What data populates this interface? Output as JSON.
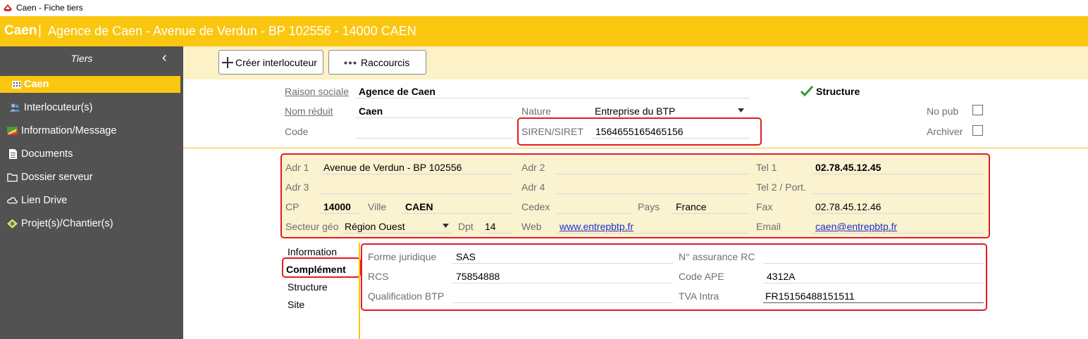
{
  "window": {
    "title": "Caen - Fiche tiers"
  },
  "header": {
    "name": "Caen",
    "separator": "|",
    "address": "Agence de Caen - Avenue de Verdun - BP 102556 - 14000 CAEN"
  },
  "sidebar": {
    "title": "Tiers",
    "collapse_glyph": "‹",
    "items": [
      {
        "label": "Caen",
        "icon": "building-icon"
      },
      {
        "label": "Interlocuteur(s)",
        "icon": "people-icon"
      },
      {
        "label": "Information/Message",
        "icon": "flag-icon"
      },
      {
        "label": "Documents",
        "icon": "document-icon"
      },
      {
        "label": "Dossier serveur",
        "icon": "folder-icon"
      },
      {
        "label": "Lien Drive",
        "icon": "cloud-icon"
      },
      {
        "label": "Projet(s)/Chantier(s)",
        "icon": "project-icon"
      }
    ]
  },
  "toolbar": {
    "create_label": "Créer interlocuteur",
    "shortcuts_label": "Raccourcis"
  },
  "identity": {
    "raison_sociale_label": "Raison sociale",
    "raison_sociale": "Agence de Caen",
    "structure_label": "Structure",
    "nom_reduit_label": "Nom réduit",
    "nom_reduit": "Caen",
    "nature_label": "Nature",
    "nature": "Entreprise du BTP",
    "no_pub_label": "No pub",
    "code_label": "Code",
    "code": "",
    "siren_label": "SIREN/SIRET",
    "siren": "1564655165465156",
    "archiver_label": "Archiver"
  },
  "address": {
    "adr1_label": "Adr 1",
    "adr1": "Avenue de Verdun - BP 102556",
    "adr2_label": "Adr 2",
    "adr2": "",
    "tel1_label": "Tel 1",
    "tel1": "02.78.45.12.45",
    "adr3_label": "Adr 3",
    "adr3": "",
    "adr4_label": "Adr 4",
    "adr4": "",
    "tel2_label": "Tel 2 / Port.",
    "tel2": "",
    "cp_label": "CP",
    "cp": "14000",
    "ville_label": "Ville",
    "ville": "CAEN",
    "cedex_label": "Cedex",
    "cedex": "",
    "pays_label": "Pays",
    "pays": "France",
    "fax_label": "Fax",
    "fax": "02.78.45.12.46",
    "secteur_label": "Secteur géo",
    "secteur": "Région Ouest",
    "dpt_label": "Dpt",
    "dpt": "14",
    "web_label": "Web",
    "web": "www.entrepbtp.fr",
    "email_label": "Email",
    "email": "caen@entrepbtp.fr"
  },
  "tabs": [
    "Information",
    "Complément",
    "Structure",
    "Site"
  ],
  "complement": {
    "forme_label": "Forme juridique",
    "forme": "SAS",
    "assurance_label": "N° assurance RC",
    "assurance": "",
    "rcs_label": "RCS",
    "rcs": "75854888",
    "ape_label": "Code APE",
    "ape": "4312A",
    "qualif_label": "Qualification BTP",
    "qualif": "",
    "tva_label": "TVA Intra",
    "tva": "FR15156488151511"
  },
  "colors": {
    "accent": "#fbc60f",
    "sidebar": "#525252",
    "highlight": "#e31b23",
    "panel": "#fbf2cf",
    "toolbar": "#fdf1c8",
    "link": "#1f2fc9",
    "check": "#2e9a3a"
  }
}
